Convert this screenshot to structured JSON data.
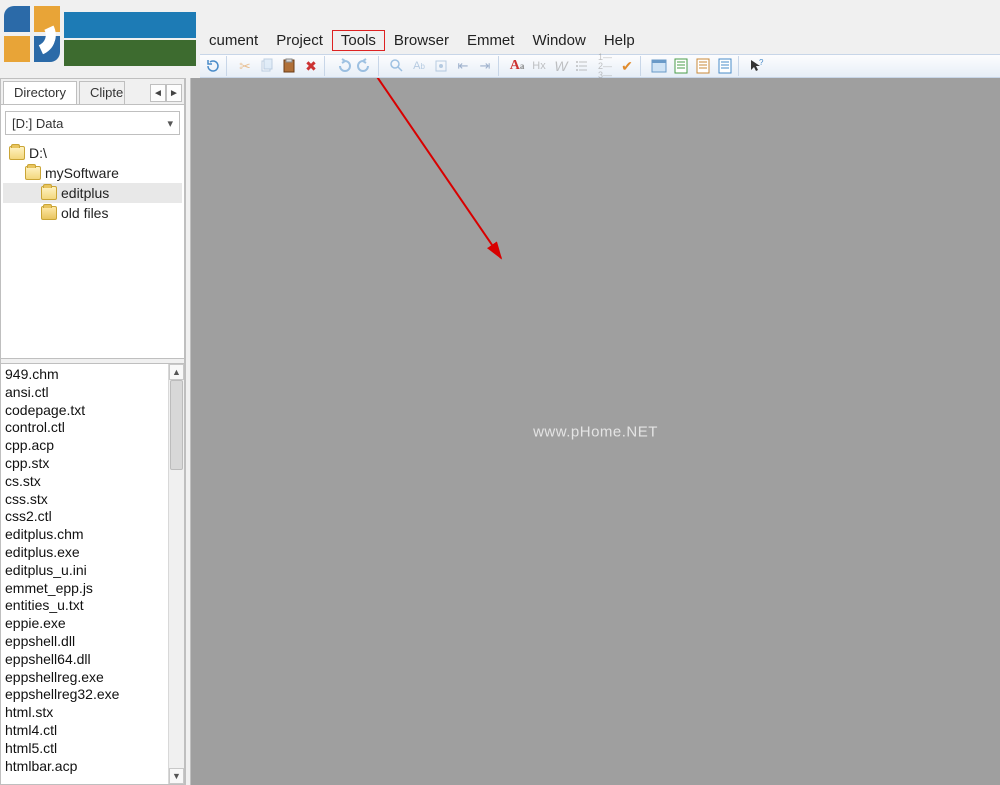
{
  "menu": {
    "cument": "cument",
    "project": "Project",
    "tools": "Tools",
    "browser": "Browser",
    "emmet": "Emmet",
    "window": "Window",
    "help": "Help"
  },
  "sidebar": {
    "tabs": {
      "directory": "Directory",
      "cliptext": "Clipte"
    },
    "drive": "[D:] Data",
    "tree": {
      "root": "D:\\",
      "n1": "mySoftware",
      "n2": "editplus",
      "n3": "old files"
    },
    "files": [
      "949.chm",
      "ansi.ctl",
      "codepage.txt",
      "control.ctl",
      "cpp.acp",
      "cpp.stx",
      "cs.stx",
      "css.stx",
      "css2.ctl",
      "editplus.chm",
      "editplus.exe",
      "editplus_u.ini",
      "emmet_epp.js",
      "entities_u.txt",
      "eppie.exe",
      "eppshell.dll",
      "eppshell64.dll",
      "eppshellreg.exe",
      "eppshellreg32.exe",
      "html.stx",
      "html4.ctl",
      "html5.ctl",
      "htmlbar.acp"
    ]
  },
  "watermark": "www.pHome.NET",
  "toolbar_icons": [
    "refresh-icon",
    "cut-icon",
    "copy-icon",
    "paste-icon",
    "delete-icon",
    "undo-icon",
    "redo-icon",
    "search-icon",
    "replace-icon",
    "marker-icon",
    "indent-left-icon",
    "indent-right-icon",
    "font-icon",
    "heading-icon",
    "word-icon",
    "list-icon",
    "numbered-list-icon",
    "check-icon",
    "preview-icon",
    "page-icon",
    "page2-icon",
    "page3-icon",
    "help-cursor-icon"
  ]
}
